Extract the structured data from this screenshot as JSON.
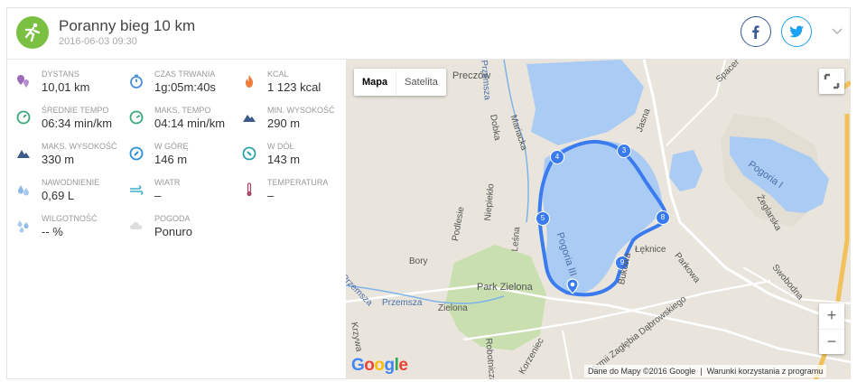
{
  "activity": {
    "title": "Poranny bieg 10 km",
    "date": "2016-06-03 09:30",
    "sport_icon": "running-person-icon",
    "accent_color": "#7bc043"
  },
  "social": {
    "facebook_icon": "facebook-icon",
    "twitter_icon": "twitter-icon"
  },
  "stats": [
    {
      "label": "DYSTANS",
      "value": "10,01 km",
      "icon": "distance-pin-icon"
    },
    {
      "label": "CZAS TRWANIA",
      "value": "1g:05m:40s",
      "icon": "stopwatch-icon"
    },
    {
      "label": "KCAL",
      "value": "1 123 kcal",
      "icon": "flame-icon"
    },
    {
      "label": "ŚREDNIE TEMPO",
      "value": "06:34 min/km",
      "icon": "speedometer-icon"
    },
    {
      "label": "MAKS. TEMPO",
      "value": "04:14 min/km",
      "icon": "speedometer-icon"
    },
    {
      "label": "MIN. WYSOKOŚĆ",
      "value": "290 m",
      "icon": "mountain-icon"
    },
    {
      "label": "MAKS. WYSOKOŚĆ",
      "value": "330 m",
      "icon": "mountain-icon"
    },
    {
      "label": "W GÓRĘ",
      "value": "146 m",
      "icon": "compass-up-icon"
    },
    {
      "label": "W DÓŁ",
      "value": "143 m",
      "icon": "compass-down-icon"
    },
    {
      "label": "NAWODNIENIE",
      "value": "0,69 L",
      "icon": "water-drops-icon"
    },
    {
      "label": "WIATR",
      "value": "–",
      "icon": "wind-icon"
    },
    {
      "label": "TEMPERATURA",
      "value": "–",
      "icon": "thermometer-icon"
    },
    {
      "label": "WILGOTNOŚĆ",
      "value": "-- %",
      "icon": "humidity-icon"
    },
    {
      "label": "POGODA",
      "value": "Ponuro",
      "icon": "cloud-icon"
    }
  ],
  "map": {
    "map_tab": "Mapa",
    "satellite_tab": "Satelita",
    "zoom_in": "+",
    "zoom_out": "−",
    "google_logo": "Google",
    "attribution": "Dane do Mapy ©2016 Google",
    "terms": "Warunki korzystania z programu",
    "labels": {
      "preczow": "Preczów",
      "pogoria3": "Pogoria III",
      "pogoria1": "Pogoria I",
      "park": "Park Zielona",
      "leknice": "Łęknice",
      "parkowa": "Parkowa",
      "bory": "Bory",
      "zielona": "Zielona",
      "przemsza": "Przemsza",
      "swoboda": "Swobodna",
      "zeglarska": "Żeglarska",
      "jasna": "Jasna",
      "spacer": "Spacer",
      "bukowa": "Bukowa",
      "podlesie": "Podlesie",
      "niepiekla": "Niepiekło",
      "lesna": "Leśna",
      "mariacka": "Mariacka",
      "dobka": "Dobka",
      "krzywa": "Krzywa",
      "korzeniec": "Korzeniec",
      "robotnicza": "Robotnicza",
      "zaglebia": "Armii Zagłębia Dąbrowskiego",
      "przemsza_south": "Przemsza",
      "przemsza_north": "Przemsza"
    },
    "waypoints": [
      "3",
      "4",
      "5",
      "8",
      "9"
    ]
  }
}
